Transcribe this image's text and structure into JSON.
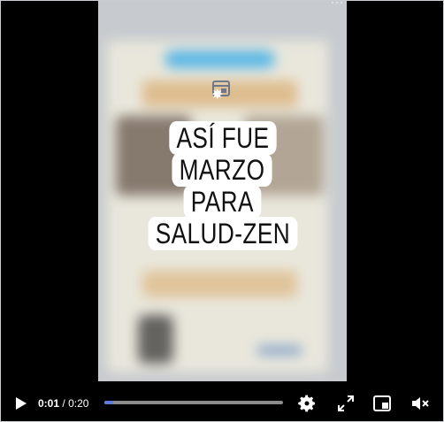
{
  "video": {
    "overlay_lines": [
      "ASÍ FUE",
      "MARZO",
      "PARA",
      "SALUD-ZEN"
    ],
    "more_label": "···"
  },
  "controls": {
    "current_time": "0:01",
    "separator": "/",
    "duration": "0:20",
    "progress_fraction": 0.05,
    "accent_color": "#5b7dd8",
    "icons": [
      "play-icon",
      "settings-icon",
      "fullscreen-icon",
      "picture-in-picture-icon",
      "volume-muted-icon"
    ]
  }
}
